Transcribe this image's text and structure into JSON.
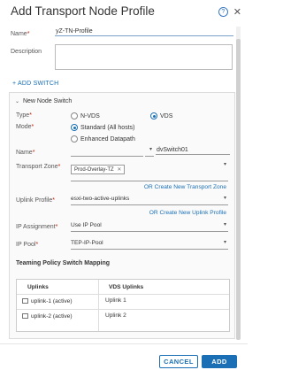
{
  "dialog": {
    "title": "Add Transport Node Profile"
  },
  "form": {
    "name_label": "Name",
    "name_value": "yZ-TN-Profile",
    "description_label": "Description",
    "description_value": "",
    "add_switch_label": "+ ADD SWITCH"
  },
  "switch_panel": {
    "header": "New Node Switch",
    "type_label": "Type",
    "type_options": [
      "N-VDS",
      "VDS"
    ],
    "type_selected": "VDS",
    "mode_label": "Mode",
    "mode_options": [
      "Standard (All hosts)",
      "Enhanced Datapath"
    ],
    "mode_selected": "Standard (All hosts)",
    "name_label": "Name",
    "name_value": "dvSwitch01",
    "transport_zone_label": "Transport Zone",
    "transport_zone_tag": "Prod-Overlay-TZ",
    "transport_zone_link": "OR Create New Transport Zone",
    "uplink_profile_label": "Uplink Profile",
    "uplink_profile_value": "esxi-two-active-uplinks",
    "uplink_profile_link": "OR Create New Uplink Profile",
    "ip_assignment_label": "IP Assignment",
    "ip_assignment_value": "Use IP Pool",
    "ip_pool_label": "IP Pool",
    "ip_pool_value": "TEP-IP-Pool",
    "teaming_title": "Teaming Policy Switch Mapping",
    "teaming_columns": [
      "Uplinks",
      "VDS Uplinks"
    ],
    "teaming_rows": [
      {
        "uplink": "uplink-1 (active)",
        "vds_uplink": "Uplink 1"
      },
      {
        "uplink": "uplink-2 (active)",
        "vds_uplink": "Uplink 2"
      }
    ]
  },
  "buttons": {
    "cancel": "CANCEL",
    "add": "ADD"
  },
  "colors": {
    "accent": "#1a6fb5",
    "required": "#c21d00"
  }
}
